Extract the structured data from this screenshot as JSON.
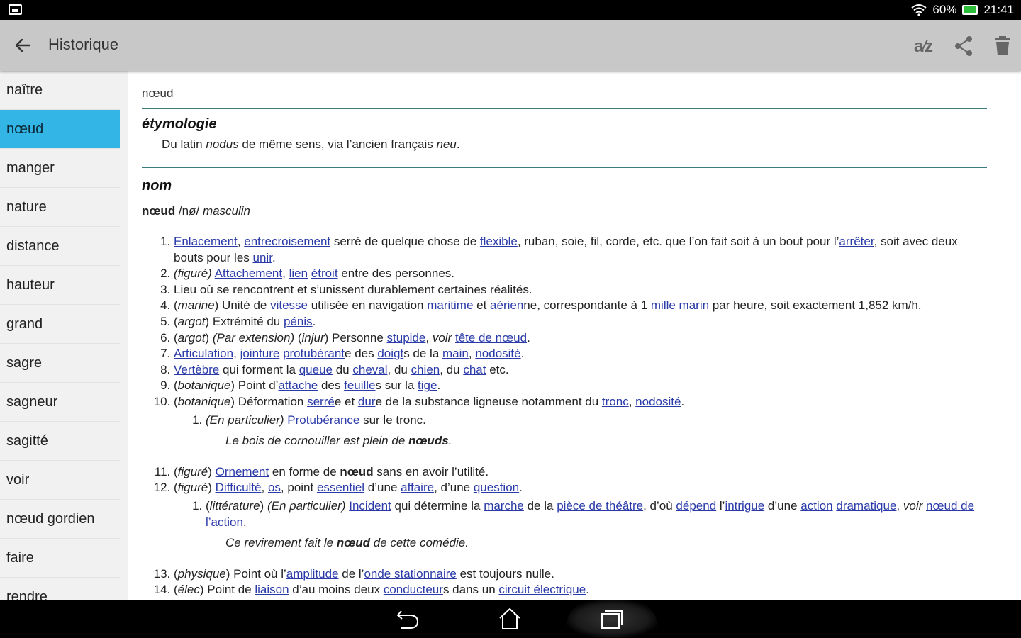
{
  "statusbar": {
    "battery": "60%",
    "time": "21:41"
  },
  "appbar": {
    "title": "Historique",
    "actions": {
      "sort": "sort-az-icon",
      "share": "share-icon",
      "delete": "trash-icon"
    }
  },
  "sidebar": {
    "items": [
      "naître",
      "nœud",
      "manger",
      "nature",
      "distance",
      "hauteur",
      "grand",
      "sagre",
      "sagneur",
      "sagitté",
      "voir",
      "nœud gordien",
      "faire",
      "rendre"
    ],
    "selected_index": 1
  },
  "entry": {
    "headword": "nœud",
    "etym_title": "étymologie",
    "etym": {
      "pre": "Du latin ",
      "latin": "nodus",
      "mid": " de même sens, via l’ancien français ",
      "old": "neu",
      "post": "."
    },
    "pos_title": "nom",
    "grammar": {
      "word": "nœud",
      "pron": " /nø/ ",
      "gender": "masculin"
    },
    "def1": {
      "l1": "Enlacement",
      "s1": ", ",
      "l2": "entrecroisement",
      "t1": " serré de quelque chose de ",
      "l3": "flexible",
      "t2": ", ruban, soie, fil, corde, etc. que l’on fait soit à un bout pour l’",
      "l4": "arrêter",
      "t3": ", soit avec deux bouts pour les ",
      "l5": "unir",
      "t4": "."
    },
    "def2": {
      "tag": "(figuré)",
      "sp": " ",
      "l1": "Attachement",
      "s1": ", ",
      "l2": "lien",
      "sp2": " ",
      "l3": "étroit",
      "t1": " entre des personnes."
    },
    "def3": {
      "t1": "Lieu où se rencontrent et s’unissent durablement certaines réalités."
    },
    "def4": {
      "o": "(",
      "tag": "marine",
      "c": ")",
      "t1": " Unité de ",
      "l1": "vitesse",
      "t2": " utilisée en navigation ",
      "l2": "maritime",
      "t3": " et ",
      "l3": "aérien",
      "t4": "ne, correspondante à 1 ",
      "l4": "mille marin",
      "t5": " par heure, soit exactement 1,852 km/h."
    },
    "def5": {
      "o": "(",
      "tag": "argot",
      "c": ")",
      "t1": " Extrémité du ",
      "l1": "pénis",
      "t2": "."
    },
    "def6": {
      "o": "(",
      "tag": "argot",
      "c": ")",
      "sp": " ",
      "tag2": "(Par extension)",
      "sp2": " ",
      "o2": "(",
      "tag3": "injur",
      "c2": ")",
      "t1": " Personne ",
      "l1": "stupide",
      "t2": ", ",
      "voir": "voir",
      "sp3": " ",
      "l2": "tête de nœud",
      "t3": "."
    },
    "def7": {
      "l1": "Articulation",
      "s1": ", ",
      "l2": "jointure",
      "sp": " ",
      "l3": "protubérant",
      "t1": "e des ",
      "l4": "doigt",
      "t2": "s de la ",
      "l5": "main",
      "s2": ", ",
      "l6": "nodosité",
      "t3": "."
    },
    "def8": {
      "l1": "Vertèbre",
      "t1": " qui forment la ",
      "l2": "queue",
      "t2": " du ",
      "l3": "cheval",
      "t3": ", du ",
      "l4": "chien",
      "t4": ", du ",
      "l5": "chat",
      "t5": " etc."
    },
    "def9": {
      "o": "(",
      "tag": "botanique",
      "c": ")",
      "t1": " Point d’",
      "l1": "attache",
      "t2": " des ",
      "l2": "feuille",
      "t3": "s sur la ",
      "l3": "tige",
      "t4": "."
    },
    "def10": {
      "o": "(",
      "tag": "botanique",
      "c": ")",
      "t1": " Déformation ",
      "l1": "serré",
      "t2": "e et ",
      "l2": "dur",
      "t3": "e de la substance ligneuse notamment du ",
      "l3": "tronc",
      "s1": ", ",
      "l4": "nodosité",
      "t4": "."
    },
    "def10_1": {
      "tag": "(En particulier)",
      "sp": " ",
      "l1": "Protubérance",
      "t1": " sur le tronc."
    },
    "ex10": {
      "t1": "Le bois de cornouiller est plein de ",
      "b": "nœuds",
      "t2": "."
    },
    "def11": {
      "o": "(",
      "tag": "figuré",
      "c": ")",
      "sp": " ",
      "l1": "Ornement",
      "t1": " en forme de ",
      "b": "nœud",
      "t2": " sans en avoir l’utilité."
    },
    "def12": {
      "o": "(",
      "tag": "figuré",
      "c": ")",
      "sp": " ",
      "l1": "Difficulté",
      "s1": ", ",
      "l2": "os",
      "t1": ", point ",
      "l3": "essentiel",
      "t2": " d’une ",
      "l4": "affaire",
      "t3": ", d’une ",
      "l5": "question",
      "t4": "."
    },
    "def12_1": {
      "o": "(",
      "tag": "littérature",
      "c": ")",
      "sp": " ",
      "tag2": "(En particulier)",
      "sp2": " ",
      "l1": "Incident",
      "t1": " qui détermine la ",
      "l2": "marche",
      "t2": " de la ",
      "l3": "pièce de théâtre",
      "t3": ", d’où ",
      "l4": "dépend",
      "t4": " l’",
      "l5": "intrigue",
      "t5": " d’une ",
      "l6": "action",
      "sp3": " ",
      "l7": "dramatique",
      "t6": ", ",
      "voir": "voir",
      "sp4": " ",
      "l8": "nœud de l’action",
      "t7": "."
    },
    "ex12": {
      "t1": "Ce revirement fait le ",
      "b": "nœud",
      "t2": " de cette comédie."
    },
    "def13": {
      "o": "(",
      "tag": "physique",
      "c": ")",
      "t1": " Point où l’",
      "l1": "amplitude",
      "t2": " de l’",
      "l2": "onde stationnaire",
      "t3": " est toujours nulle."
    },
    "def14": {
      "o": "(",
      "tag": "élec",
      "c": ")",
      "t1": " Point de ",
      "l1": "liaison",
      "t2": " d’au moins deux ",
      "l2": "conducteur",
      "t3": "s dans un ",
      "l3": "circuit électrique",
      "t4": "."
    }
  },
  "navbar": {
    "back": "back-icon",
    "home": "home-icon",
    "recent": "recent-apps-icon"
  }
}
